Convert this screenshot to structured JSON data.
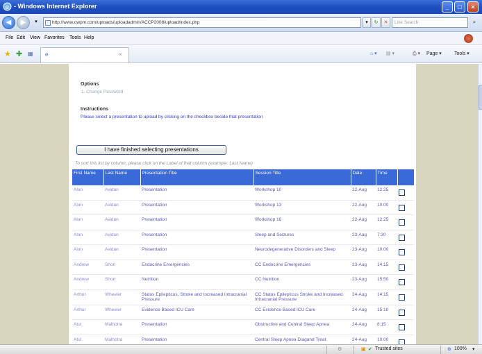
{
  "window": {
    "title": "- Windows Internet Explorer",
    "min_glyph": "_",
    "max_glyph": "□",
    "close_glyph": "×"
  },
  "nav": {
    "back_glyph": "◀",
    "forward_glyph": "▶",
    "url": "http://www.owpm.com/uploads/uploadadmin/ACCP2008/upload/index.php",
    "search_placeholder": "Live Search",
    "search_glyph": "⌕"
  },
  "menu": [
    "File",
    "Edit",
    "View",
    "Favorites",
    "Tools",
    "Help"
  ],
  "toolbar": {
    "tab_glyph": "e",
    "tab_close": "×",
    "page_label": "Page ▾",
    "tools_label": "Tools ▾"
  },
  "page": {
    "options_heading": "Options",
    "options_link": "1. Change Password",
    "instructions_heading": "Instructions",
    "instructions_text": "Please select a presentation to upload by clicking on the checkbox beside that presentation",
    "finish_button": "I have finished selecting presentations",
    "sort_note": "To sort this list by column, please click on the Label of that column (example: Last Name)"
  },
  "table": {
    "headers": [
      "First Name",
      "Last Name",
      "Presentation Title",
      "Session Title",
      "Date",
      "Time"
    ],
    "rows": [
      {
        "first": "Alon",
        "last": "Avidan",
        "presentation": "Presentation",
        "session": "Workshop 10",
        "date": "22-Aug",
        "time": "12:25"
      },
      {
        "first": "Alon",
        "last": "Avidan",
        "presentation": "Presentation",
        "session": "Workshop 13",
        "date": "22-Aug",
        "time": "10:00"
      },
      {
        "first": "Alon",
        "last": "Avidan",
        "presentation": "Presentation",
        "session": "Workshop 16",
        "date": "22-Aug",
        "time": "12:25"
      },
      {
        "first": "Alon",
        "last": "Avidan",
        "presentation": "Presentation",
        "session": "Sleep and Seizures",
        "date": "23-Aug",
        "time": "7:30"
      },
      {
        "first": "Alon",
        "last": "Avidan",
        "presentation": "Presentation",
        "session": "Neurodegenerative Disorders and Sleep",
        "date": "23-Aug",
        "time": "10:00"
      },
      {
        "first": "Andrew",
        "last": "Shorr",
        "presentation": "Endocrine Emergencies",
        "session": "CC Endocrine Emergencies",
        "date": "23-Aug",
        "time": "14:15"
      },
      {
        "first": "Andrew",
        "last": "Shorr",
        "presentation": "Nutrition",
        "session": "CC Nutrition",
        "date": "23-Aug",
        "time": "15:50"
      },
      {
        "first": "Arthur",
        "last": "Wheeler",
        "presentation": "Status Epilepticus, Stroke and Increased Intracranial Pressure",
        "session": "CC Status Epilepticus Stroke and Increased Intracranial Pressure",
        "date": "24-Aug",
        "time": "14:15"
      },
      {
        "first": "Arthur",
        "last": "Wheeler",
        "presentation": "Evidence Based ICU Care",
        "session": "CC Evidence Based ICU Care",
        "date": "24-Aug",
        "time": "15:10"
      },
      {
        "first": "Atul",
        "last": "Malhotra",
        "presentation": "Presentation",
        "session": "Obstructive and Central Sleep Apnea",
        "date": "24-Aug",
        "time": "8:15"
      },
      {
        "first": "Atul",
        "last": "Malhotra",
        "presentation": "Presentation",
        "session": "Central Sleep Apnea Diagand Treat",
        "date": "24-Aug",
        "time": "10:00"
      }
    ]
  },
  "status": {
    "zone": "Trusted sites",
    "zoom": "100%"
  }
}
